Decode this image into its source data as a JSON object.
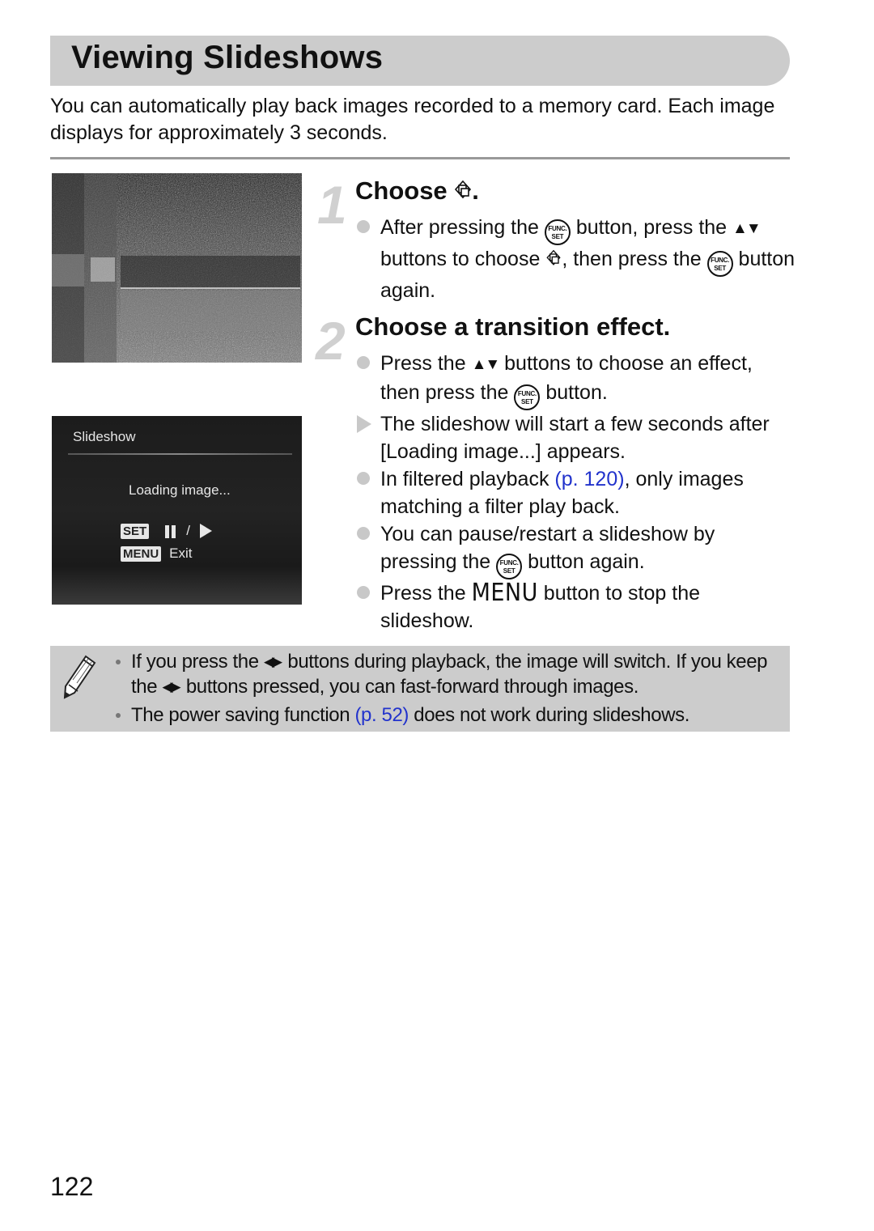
{
  "header": {
    "title": "Viewing Slideshows",
    "intro": "You can automatically play back images recorded to a memory card. Each image displays for approximately 3 seconds."
  },
  "screens": {
    "menu_screen": {
      "description": "Camera FUNC. menu with slideshow icon selected (noisy screenshot)"
    },
    "slideshow_screen": {
      "title": "Slideshow",
      "loading": "Loading image...",
      "set_key": "SET",
      "separator": "/",
      "menu_key": "MENU",
      "exit_label": "Exit"
    }
  },
  "steps": [
    {
      "number": "1",
      "title_prefix": "Choose ",
      "title_suffix": ".",
      "bullets": [
        {
          "type": "dot",
          "parts": {
            "a": "After pressing the ",
            "b": " button, press the ",
            "c": " buttons to choose ",
            "d": ", then press the ",
            "e": " button again."
          }
        }
      ]
    },
    {
      "number": "2",
      "title": "Choose a transition effect.",
      "bullets": [
        {
          "type": "dot",
          "parts": {
            "a": "Press the ",
            "b": " buttons to choose an effect, then press the ",
            "c": " button."
          }
        },
        {
          "type": "triangle",
          "text": "The slideshow will start a few seconds after [Loading image...] appears."
        },
        {
          "type": "dot",
          "parts": {
            "a": "In filtered playback ",
            "link": "(p. 120)",
            "b": ", only images matching a filter play back."
          }
        },
        {
          "type": "dot",
          "parts": {
            "a": "You can pause/restart a slideshow by pressing the ",
            "b": " button again."
          }
        },
        {
          "type": "dot",
          "parts": {
            "a": "Press the ",
            "menu": "MENU",
            "b": " button to stop the slideshow."
          }
        }
      ]
    }
  ],
  "icons": {
    "func_set_top": "FUNC.",
    "func_set_bottom": "SET",
    "up_down": "▲▼",
    "left_right": "◀▶"
  },
  "note": {
    "items": [
      {
        "a": "If you press the ",
        "b": " buttons during playback, the image will switch. If you keep the ",
        "c": " buttons pressed, you can fast-forward through images."
      },
      {
        "a": "The power saving function ",
        "link": "(p. 52)",
        "b": " does not work during slideshows."
      }
    ]
  },
  "page_number": "122",
  "colors": {
    "link": "#2233cc",
    "title_bar": "#cccccc",
    "note_bg": "#cccccc",
    "bullet": "#c8c8c8"
  }
}
